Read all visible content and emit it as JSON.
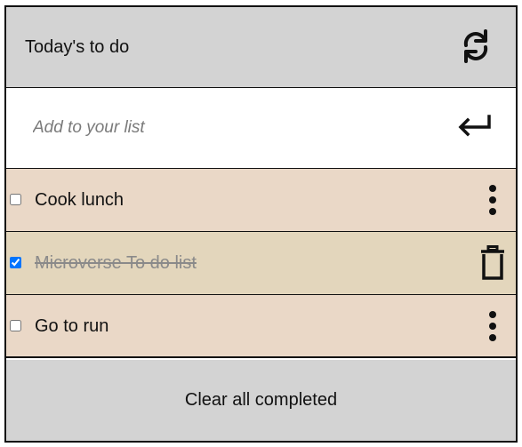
{
  "header": {
    "title": "Today's to do",
    "refresh_icon": "refresh-icon"
  },
  "add_row": {
    "placeholder": "Add to your list",
    "value": "",
    "enter_icon": "enter-return-icon"
  },
  "todos": [
    {
      "label": "Cook lunch",
      "completed": false,
      "action_icon": "more-vertical-icon"
    },
    {
      "label": "Microverse To do list",
      "completed": true,
      "action_icon": "trash-icon"
    },
    {
      "label": "Go to run",
      "completed": false,
      "action_icon": "more-vertical-icon"
    }
  ],
  "footer": {
    "clear_label": "Clear all completed"
  },
  "colors": {
    "header_bg": "#d3d3d3",
    "item_bg": "#ead8c7",
    "item_done_bg": "#e3d6bc",
    "border": "#111111",
    "done_text": "#8a8a8a",
    "checkbox_accent": "#1a73e8"
  }
}
